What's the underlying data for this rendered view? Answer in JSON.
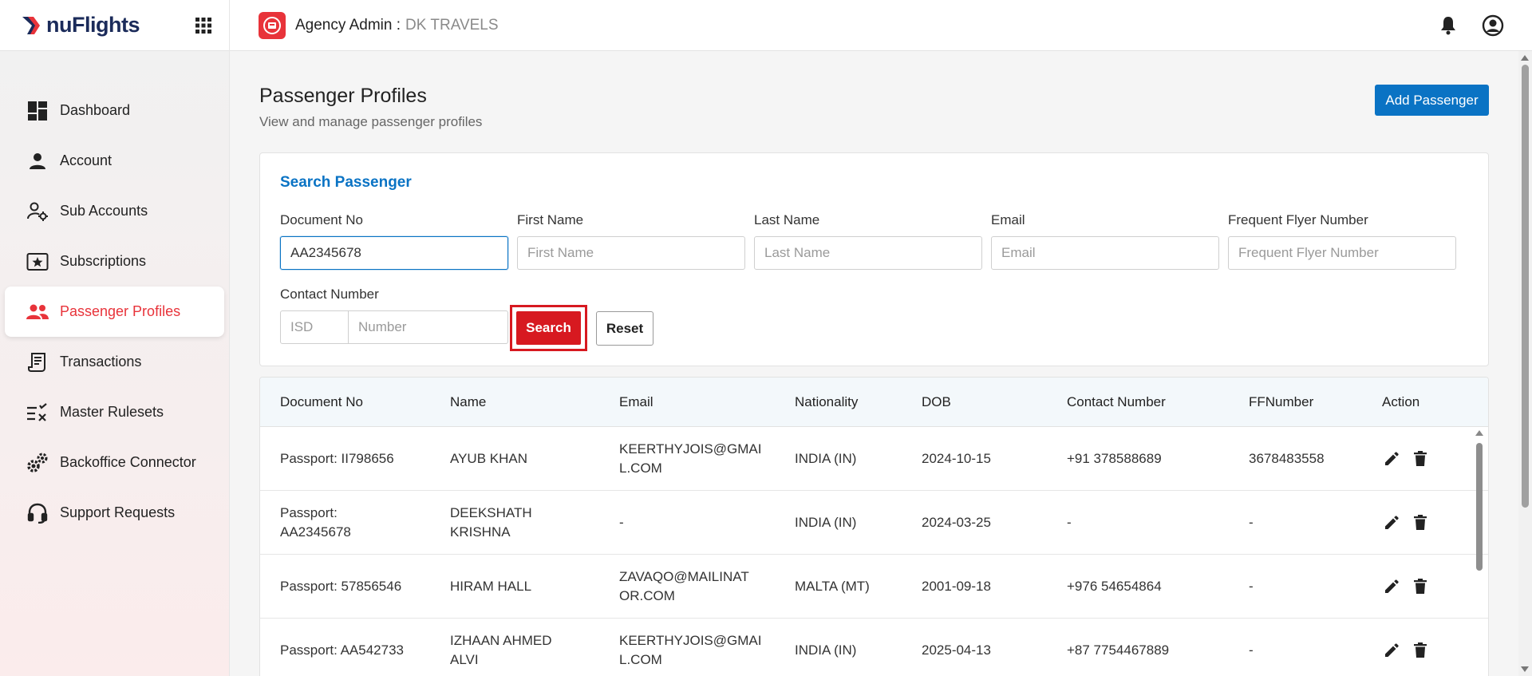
{
  "brand": {
    "logo_text": "nuFlights"
  },
  "header": {
    "agency_label": "Agency Admin :",
    "agency_name": "DK TRAVELS"
  },
  "sidebar": {
    "items": [
      {
        "label": "Dashboard",
        "icon": "dashboard-icon"
      },
      {
        "label": "Account",
        "icon": "person-icon"
      },
      {
        "label": "Sub Accounts",
        "icon": "user-settings-icon"
      },
      {
        "label": "Subscriptions",
        "icon": "star-ticket-icon"
      },
      {
        "label": "Passenger Profiles",
        "icon": "people-icon",
        "active": true
      },
      {
        "label": "Transactions",
        "icon": "receipt-icon"
      },
      {
        "label": "Master Rulesets",
        "icon": "rules-icon"
      },
      {
        "label": "Backoffice Connector",
        "icon": "gears-icon"
      },
      {
        "label": "Support Requests",
        "icon": "headset-icon"
      }
    ]
  },
  "page": {
    "title": "Passenger Profiles",
    "subtitle": "View and manage passenger profiles",
    "add_button": "Add Passenger"
  },
  "search": {
    "title": "Search Passenger",
    "document_no": {
      "label": "Document No",
      "value": "AA2345678"
    },
    "first_name": {
      "label": "First Name",
      "placeholder": "First Name"
    },
    "last_name": {
      "label": "Last Name",
      "placeholder": "Last Name"
    },
    "email": {
      "label": "Email",
      "placeholder": "Email"
    },
    "ff_number": {
      "label": "Frequent Flyer Number",
      "placeholder": "Frequent Flyer Number"
    },
    "contact": {
      "label": "Contact Number",
      "isd_placeholder": "ISD",
      "number_placeholder": "Number"
    },
    "search_button": "Search",
    "reset_button": "Reset"
  },
  "table": {
    "columns": [
      "Document No",
      "Name",
      "Email",
      "Nationality",
      "DOB",
      "Contact Number",
      "FFNumber",
      "Action"
    ],
    "rows": [
      {
        "doc1": "Passport: II798656",
        "doc2": "",
        "name1": "AYUB KHAN",
        "name2": "",
        "email1": "KEERTHYJOIS@GMAI",
        "email2": "L.COM",
        "nationality": "INDIA (IN)",
        "dob": "2024-10-15",
        "contact": "+91 378588689",
        "ff": "3678483558"
      },
      {
        "doc1": "Passport:",
        "doc2": "AA2345678",
        "name1": "DEEKSHATH",
        "name2": "KRISHNA",
        "email1": "-",
        "email2": "",
        "nationality": "INDIA (IN)",
        "dob": "2024-03-25",
        "contact": "-",
        "ff": "-"
      },
      {
        "doc1": "Passport: 57856546",
        "doc2": "",
        "name1": "HIRAM HALL",
        "name2": "",
        "email1": "ZAVAQO@MAILINAT",
        "email2": "OR.COM",
        "nationality": "MALTA (MT)",
        "dob": "2001-09-18",
        "contact": "+976 54654864",
        "ff": "-"
      },
      {
        "doc1": "Passport: AA542733",
        "doc2": "",
        "name1": "IZHAAN AHMED",
        "name2": "ALVI",
        "email1": "KEERTHYJOIS@GMAI",
        "email2": "L.COM",
        "nationality": "INDIA (IN)",
        "dob": "2025-04-13",
        "contact": "+87 7754467889",
        "ff": "-"
      }
    ]
  },
  "colors": {
    "brand_red": "#e8333a",
    "search_red": "#d71920",
    "primary_blue": "#0a73c4"
  }
}
